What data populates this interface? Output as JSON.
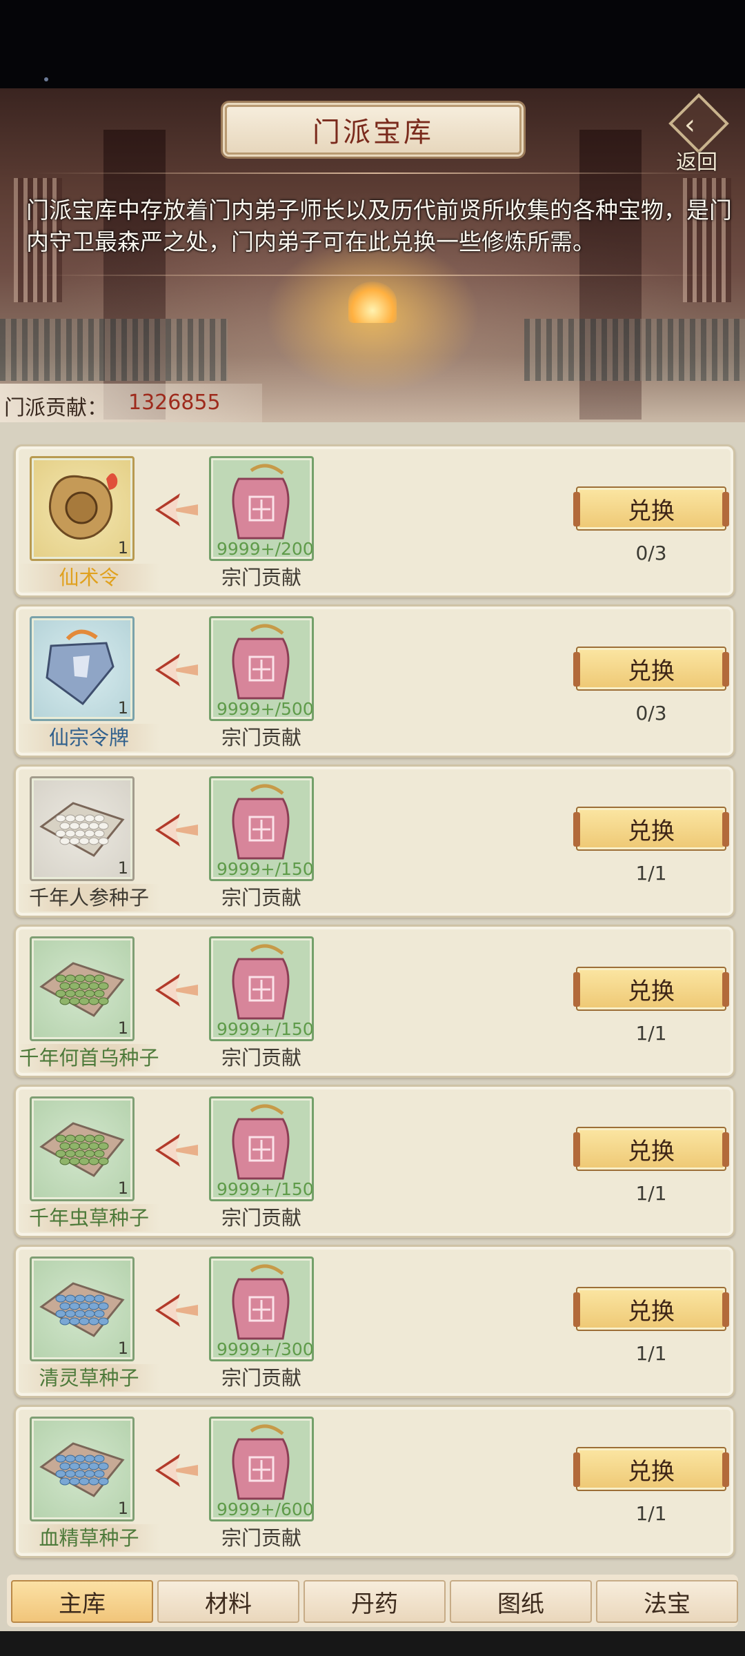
{
  "header": {
    "title": "门派宝库",
    "back_label": "返回",
    "description": "门派宝库中存放着门内弟子师长以及历代前贤所收集的各种宝物，是门内守卫最森严之处，门内弟子可在此兑换一些修炼所需。",
    "contribution_label": "门派贡献：",
    "contribution_value": "1326855"
  },
  "items": [
    {
      "name": "仙术令",
      "name_color": "#e0a11e",
      "reward_qty": "1",
      "cost_qty": "9999+/200",
      "cost_name": "宗门贡献",
      "button": "兑换",
      "limit": "0/3",
      "icon": "gold-talisman-icon"
    },
    {
      "name": "仙宗令牌",
      "name_color": "#2f5f8c",
      "reward_qty": "1",
      "cost_qty": "9999+/500",
      "cost_name": "宗门贡献",
      "button": "兑换",
      "limit": "0/3",
      "icon": "blue-token-icon"
    },
    {
      "name": "千年人参种子",
      "name_color": "#3e3a32",
      "reward_qty": "1",
      "cost_qty": "9999+/150",
      "cost_name": "宗门贡献",
      "button": "兑换",
      "limit": "1/1",
      "icon": "white-seeds-icon"
    },
    {
      "name": "千年何首乌种子",
      "name_color": "#4d7a3a",
      "reward_qty": "1",
      "cost_qty": "9999+/150",
      "cost_name": "宗门贡献",
      "button": "兑换",
      "limit": "1/1",
      "icon": "green-seeds-icon"
    },
    {
      "name": "千年虫草种子",
      "name_color": "#4d7a3a",
      "reward_qty": "1",
      "cost_qty": "9999+/150",
      "cost_name": "宗门贡献",
      "button": "兑换",
      "limit": "1/1",
      "icon": "green-seeds-icon"
    },
    {
      "name": "清灵草种子",
      "name_color": "#4d7a3a",
      "reward_qty": "1",
      "cost_qty": "9999+/300",
      "cost_name": "宗门贡献",
      "button": "兑换",
      "limit": "1/1",
      "icon": "blue-seeds-icon"
    },
    {
      "name": "血精草种子",
      "name_color": "#4d7a3a",
      "reward_qty": "1",
      "cost_qty": "9999+/600",
      "cost_name": "宗门贡献",
      "button": "兑换",
      "limit": "1/1",
      "icon": "blue-seeds-icon"
    }
  ],
  "tabs": [
    {
      "label": "主库",
      "active": true
    },
    {
      "label": "材料",
      "active": false
    },
    {
      "label": "丹药",
      "active": false
    },
    {
      "label": "图纸",
      "active": false
    },
    {
      "label": "法宝",
      "active": false
    }
  ]
}
